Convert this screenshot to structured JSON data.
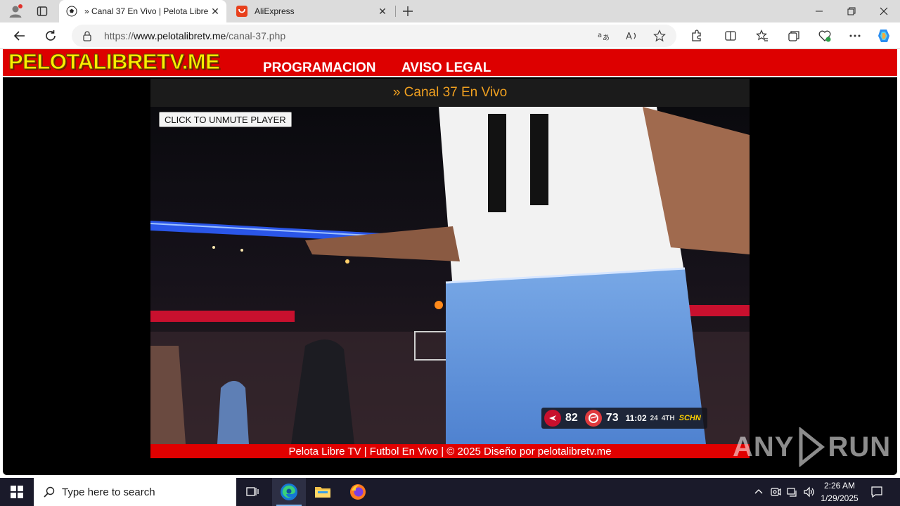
{
  "browser": {
    "tabs": [
      {
        "title": "» Canal 37 En Vivo | Pelota Libre T",
        "active": true
      },
      {
        "title": "AliExpress",
        "active": false
      }
    ],
    "url_prefix": "https://",
    "url_domain": "www.pelotalibretv.me",
    "url_path": "/canal-37.php"
  },
  "site": {
    "logo": "PELOTALIBRETV.ME",
    "nav": [
      "PROGRAMACION",
      "AVISO LEGAL"
    ],
    "player_title": "» Canal 37 En Vivo",
    "unmute_label": "CLICK TO UNMUTE PLAYER",
    "footer": "Pelota Libre TV | Futbol En Vivo | © 2025 Diseño por pelotalibretv.me"
  },
  "scorebug": {
    "home_score": "82",
    "away_score": "73",
    "clock": "11:02",
    "shot_clock": "24",
    "period": "4TH",
    "network": "SCHN"
  },
  "watermark": {
    "left": "ANY",
    "right": "RUN"
  },
  "taskbar": {
    "search_placeholder": "Type here to search",
    "time": "2:26 AM",
    "date": "1/29/2025"
  },
  "colors": {
    "site_red": "#dd0000",
    "logo_yellow": "#ffee00",
    "title_orange": "#f0a020",
    "taskbar": "#1a1a2a"
  }
}
